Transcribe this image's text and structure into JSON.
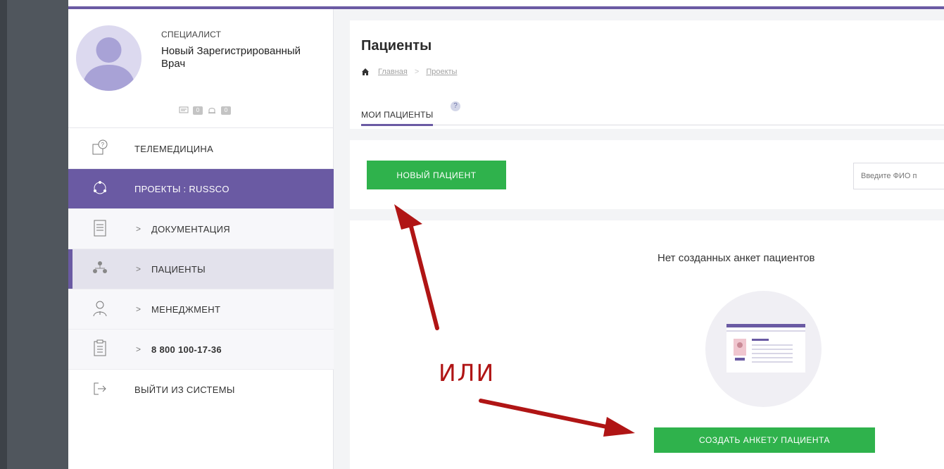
{
  "profile": {
    "role": "СПЕЦИАЛИСТ",
    "name": "Новый Зарегистрированный Врач",
    "messages_count": "0",
    "notifications_count": "0"
  },
  "menu": [
    {
      "label": "ТЕЛЕМЕДИЦИНА",
      "icon": "telemedicine-icon"
    },
    {
      "label": "ПРОЕКТЫ : RUSSCO",
      "icon": "projects-icon"
    },
    {
      "caret": ">",
      "label": "ДОКУМЕНТАЦИЯ",
      "icon": "document-icon"
    },
    {
      "caret": ">",
      "label": "ПАЦИЕНТЫ",
      "icon": "patients-icon"
    },
    {
      "caret": ">",
      "label": "МЕНЕДЖМЕНТ",
      "icon": "doctor-icon"
    },
    {
      "caret": ">",
      "label": "8 800 100-17-36",
      "icon": "checklist-icon"
    },
    {
      "label": "ВЫЙТИ ИЗ СИСТЕМЫ",
      "icon": "logout-icon"
    }
  ],
  "header": {
    "title": "Пациенты",
    "breadcrumb": [
      "Главная",
      "Проекты"
    ],
    "tab": "МОИ ПАЦИЕНТЫ",
    "help": "?"
  },
  "actions": {
    "new_patient": "НОВЫЙ ПАЦИЕНТ",
    "search_placeholder": "Введите ФИО п"
  },
  "empty_state": {
    "message": "Нет созданных анкет пациентов",
    "create_button": "СОЗДАТЬ АНКЕТУ ПАЦИЕНТА"
  },
  "annotation": {
    "text": "ИЛИ",
    "color": "#b01515"
  },
  "colors": {
    "accent": "#6a5aa3",
    "button_green": "#2fb24c"
  }
}
